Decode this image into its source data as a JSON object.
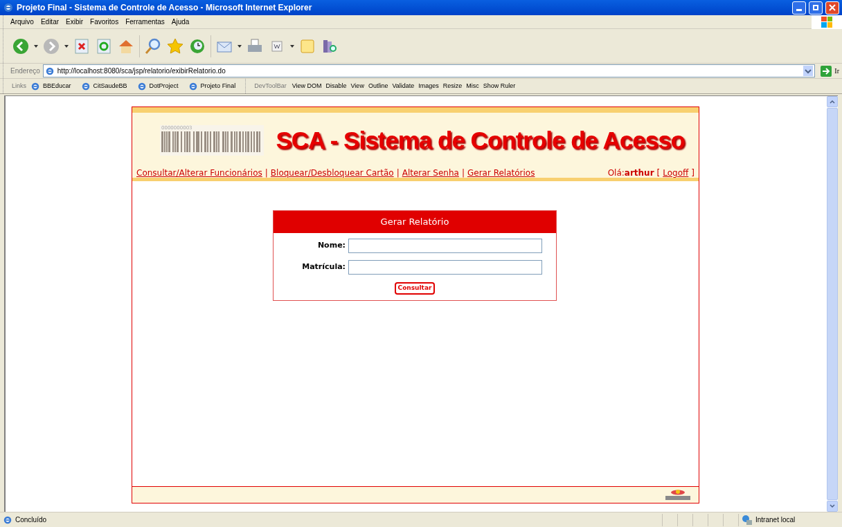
{
  "window": {
    "title": "Projeto Final - Sistema de Controle de Acesso - Microsoft Internet Explorer"
  },
  "menu": [
    "Arquivo",
    "Editar",
    "Exibir",
    "Favoritos",
    "Ferramentas",
    "Ajuda"
  ],
  "address": {
    "label": "Endereço",
    "value": "http://localhost:8080/sca/jsp/relatorio/exibirRelatorio.do",
    "go": "Ir"
  },
  "links": {
    "label": "Links",
    "items": [
      "BBEducar",
      "CitSaudeBB",
      "DotProject",
      "Projeto Final"
    ]
  },
  "devtoolbar": {
    "label": "DevToolBar",
    "items": [
      "View DOM",
      "Disable",
      "View",
      "Outline",
      "Validate",
      "Images",
      "Resize",
      "Misc",
      "Show Ruler"
    ]
  },
  "page": {
    "barcode_number": "0000000003",
    "title": "SCA - Sistema de Controle de Acesso",
    "nav": [
      "Consultar/Alterar Funcionários",
      "Bloquear/Desbloquear Cartão",
      "Alterar Senha",
      "Gerar Relatórios"
    ],
    "separator": "|",
    "greeting": "Olá:",
    "user": "arthur",
    "bracket_open": "[",
    "logoff": "Logoff",
    "bracket_close": "]"
  },
  "form": {
    "title": "Gerar Relatório",
    "fields": [
      {
        "label": "Nome:"
      },
      {
        "label": "Matrícula:"
      }
    ],
    "button": "Consultar"
  },
  "status_bar": {
    "text": "Concluído",
    "zone": "Intranet local"
  }
}
